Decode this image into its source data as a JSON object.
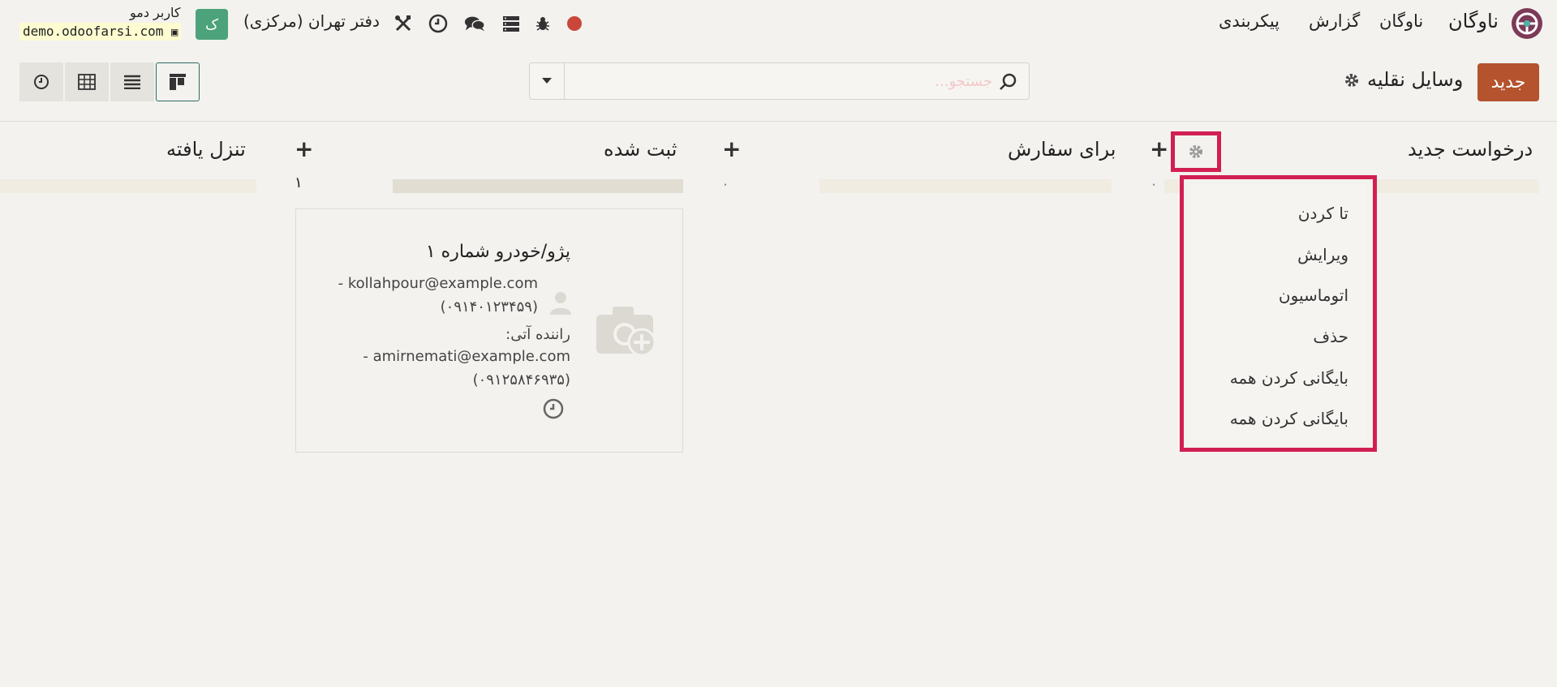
{
  "navbar": {
    "app_name": "ناوگان",
    "menus": [
      "ناوگان",
      "گزارش",
      "پیکربندی"
    ],
    "company": "دفتر تهران (مرکزی)",
    "user_initial": "ک",
    "user_name": "کاربر دمو",
    "database": "demo.odoofarsi.com",
    "systray_icons": [
      "record-dot",
      "bug-icon",
      "server-icon",
      "chat-icon",
      "clock-icon",
      "tools-icon"
    ]
  },
  "control_panel": {
    "new_button": "جدید",
    "breadcrumb": "وسایل نقلیه",
    "search_placeholder": "جستجو...",
    "views": [
      "kanban",
      "list",
      "pivot",
      "activity"
    ],
    "active_view": "kanban"
  },
  "kanban": {
    "columns": [
      {
        "title": "درخواست جدید",
        "count": "۰"
      },
      {
        "title": "برای سفارش",
        "count": "۰"
      },
      {
        "title": "ثبت شده",
        "count": "۱"
      },
      {
        "title": "تنزل یافته",
        "count": ""
      }
    ],
    "card": {
      "title": "پژو/خودرو شماره ۱",
      "driver_email": "kollahpour@example.com -",
      "driver_phone": "(۰۹۱۴۰۱۲۳۴۵۹)",
      "future_driver_label": "راننده آتی:",
      "future_driver_email": "amirnemati@example.com -",
      "future_driver_phone": "(۰۹۱۲۵۸۴۶۹۳۵)"
    }
  },
  "column_menu": {
    "items": [
      "تا کردن",
      "ویرایش",
      "اتوماسیون",
      "حذف",
      "بایگانی کردن همه",
      "بایگانی کردن همه"
    ]
  },
  "colors": {
    "brand_button": "#b4532e",
    "highlight": "#d21f52",
    "avatar": "#4ca37b",
    "record": "#c9473a"
  }
}
